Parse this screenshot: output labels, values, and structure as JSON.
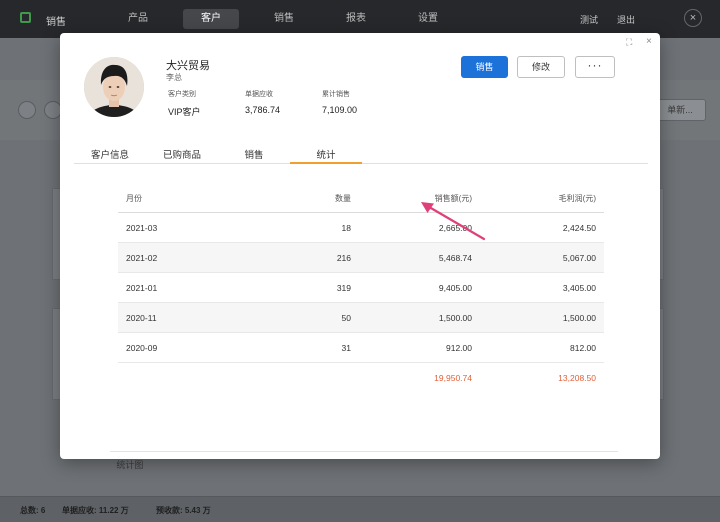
{
  "app": {
    "name": "销售",
    "nav": [
      "产品",
      "客户",
      "销售",
      "报表",
      "设置"
    ],
    "active_nav": "客户",
    "top_right": [
      "测试",
      "退出"
    ],
    "close_glyph": "×"
  },
  "background": {
    "right_button_label": "单新..."
  },
  "status": {
    "total": "总数: 6",
    "receivable": "单据应收: 11.22 万",
    "prepaid": "预收款: 5.43 万"
  },
  "modal": {
    "controls": {
      "expand_glyph": "⛶",
      "close_glyph": "×"
    },
    "customer": {
      "name": "大兴贸易",
      "contact": "李总",
      "fields": [
        {
          "label": "客户类别",
          "value": "VIP客户"
        },
        {
          "label": "单据应收",
          "value": "3,786.74"
        },
        {
          "label": "累计销售",
          "value": "7,109.00"
        }
      ]
    },
    "buttons": {
      "primary": "销售",
      "edit": "修改",
      "more": "···"
    },
    "tabs": [
      "客户信息",
      "已购商品",
      "销售",
      "统计"
    ],
    "active_tab": "统计",
    "table": {
      "headers": [
        "月份",
        "数量",
        "销售额(元)",
        "毛利润(元)"
      ],
      "rows": [
        [
          "2021-03",
          "18",
          "2,665.00",
          "2,424.50"
        ],
        [
          "2021-02",
          "216",
          "5,468.74",
          "5,067.00"
        ],
        [
          "2021-01",
          "319",
          "9,405.00",
          "3,405.00"
        ],
        [
          "2020-11",
          "50",
          "1,500.00",
          "1,500.00"
        ],
        [
          "2020-09",
          "31",
          "912.00",
          "812.00"
        ]
      ],
      "totals": [
        "",
        "",
        "19,950.74",
        "13,208.50"
      ]
    },
    "chart_toggle": "统计图"
  },
  "colors": {
    "primary": "#1d72d9",
    "tab_active": "#f0a030",
    "total_text": "#e0603a",
    "arrow": "#e0407a"
  }
}
